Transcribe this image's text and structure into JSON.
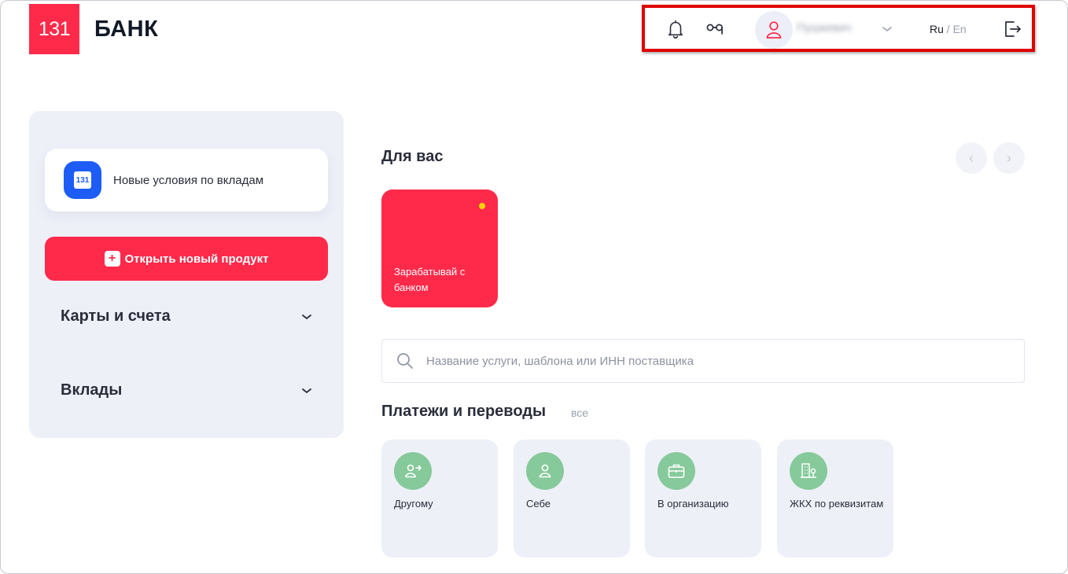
{
  "header": {
    "logo_text": "131",
    "brand_name": "БАНК",
    "username": "Пушкевич",
    "lang_ru": "Ru",
    "lang_separator": " / ",
    "lang_en": "En"
  },
  "sidebar": {
    "promo_icon_text": "131",
    "promo_text": "Новые условия по вкладам",
    "open_product_label": "Открыть новый продукт",
    "sections": [
      {
        "label": "Карты и счета"
      },
      {
        "label": "Вклады"
      }
    ]
  },
  "main": {
    "for_you_title": "Для вас",
    "nav_prev": "‹",
    "nav_next": "›",
    "offer_card_text": "Зарабатывай с банком",
    "search_placeholder": "Название услуги, шаблона или ИНН поставщика",
    "payments_title": "Платежи и переводы",
    "payments_all": "все",
    "payments": [
      {
        "label": "Другому",
        "icon": "person-transfer-icon"
      },
      {
        "label": "Себе",
        "icon": "person-icon"
      },
      {
        "label": "В организацию",
        "icon": "briefcase-icon"
      },
      {
        "label": "ЖКХ по реквизитам",
        "icon": "building-icon"
      }
    ]
  },
  "colors": {
    "brand_red": "#ff2a4a",
    "promo_blue": "#1d5df5",
    "payment_icon_green": "#86c99a",
    "panel_bg": "#eef0f8",
    "highlight_red": "#e00000"
  }
}
